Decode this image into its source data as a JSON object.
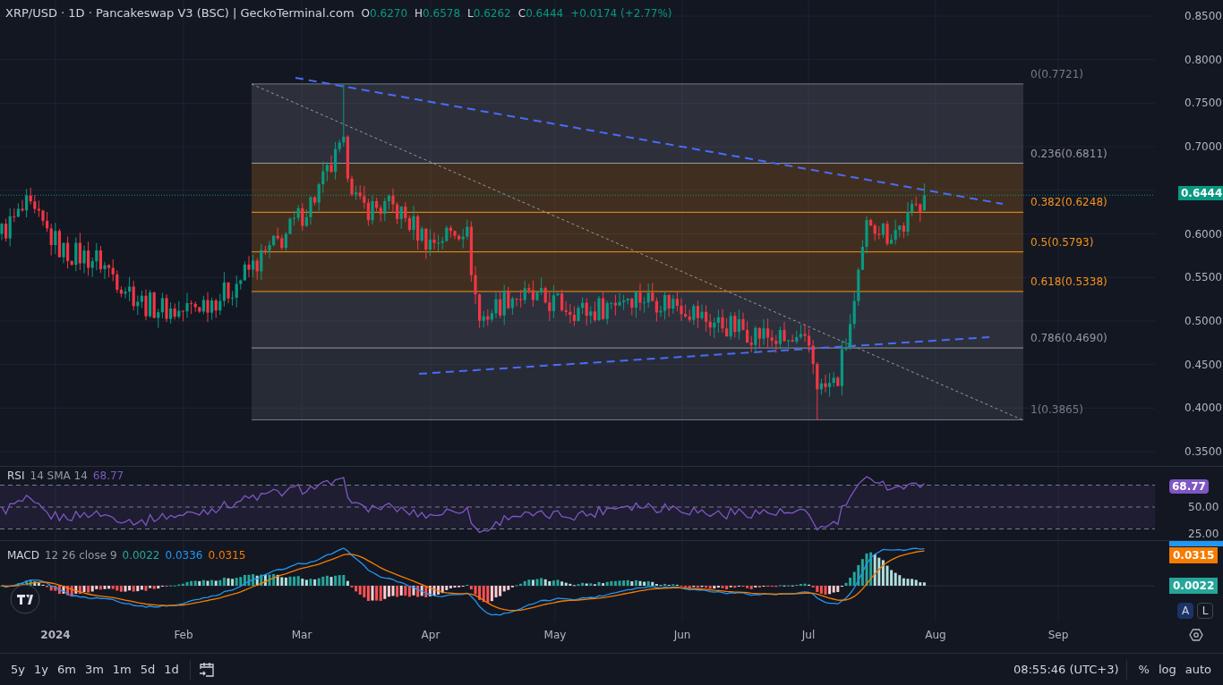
{
  "header": {
    "title": "XRP/USD · 1D · Pancakeswap V3 (BSC) | GeckoTerminal.com",
    "ohlc": [
      {
        "key": "O",
        "value": "0.6270"
      },
      {
        "key": "H",
        "value": "0.6578"
      },
      {
        "key": "L",
        "value": "0.6262"
      },
      {
        "key": "C",
        "value": "0.6444"
      }
    ],
    "change": "+0.0174 (+2.77%)"
  },
  "price_axis": {
    "ticks": [
      "0.8500",
      "0.8000",
      "0.7500",
      "0.7000",
      "0.6000",
      "0.5500",
      "0.5000",
      "0.4500",
      "0.4000",
      "0.3500"
    ],
    "last_price": "0.6444"
  },
  "fib_levels": [
    {
      "label": "0(0.7721)",
      "color": "#787b86"
    },
    {
      "label": "0.236(0.6811)",
      "color": "#9598a1"
    },
    {
      "label": "0.382(0.6248)",
      "color": "#f7931a"
    },
    {
      "label": "0.5(0.5793)",
      "color": "#f7931a"
    },
    {
      "label": "0.618(0.5338)",
      "color": "#f7931a"
    },
    {
      "label": "0.786(0.4690)",
      "color": "#9598a1"
    },
    {
      "label": "1(0.3865)",
      "color": "#787b86"
    }
  ],
  "rsi": {
    "name": "RSI",
    "params": "14 SMA 14",
    "value": "68.77",
    "axis": [
      "50.00",
      "25.00"
    ],
    "badge": "68.77"
  },
  "macd": {
    "name": "MACD",
    "params": "12 26 close 9",
    "values": [
      {
        "text": "0.0022",
        "color": "#26a69a"
      },
      {
        "text": "0.0336",
        "color": "#2196f3"
      },
      {
        "text": "0.0315",
        "color": "#f57c00"
      }
    ],
    "badges": [
      {
        "text": "0.0315",
        "color": "#f57c00"
      },
      {
        "text": "0.0022",
        "color": "#26a69a"
      }
    ]
  },
  "time_axis": [
    "2024",
    "Feb",
    "Mar",
    "Apr",
    "May",
    "Jun",
    "Jul",
    "Aug",
    "Sep"
  ],
  "scale_buttons": [
    {
      "label": "A",
      "selected": true
    },
    {
      "label": "L",
      "selected": false
    }
  ],
  "range_buttons": [
    "5y",
    "1y",
    "6m",
    "3m",
    "1m",
    "5d",
    "1d"
  ],
  "clock": "08:55:46 (UTC+3)",
  "axis_options": [
    "%",
    "log",
    "auto"
  ]
}
